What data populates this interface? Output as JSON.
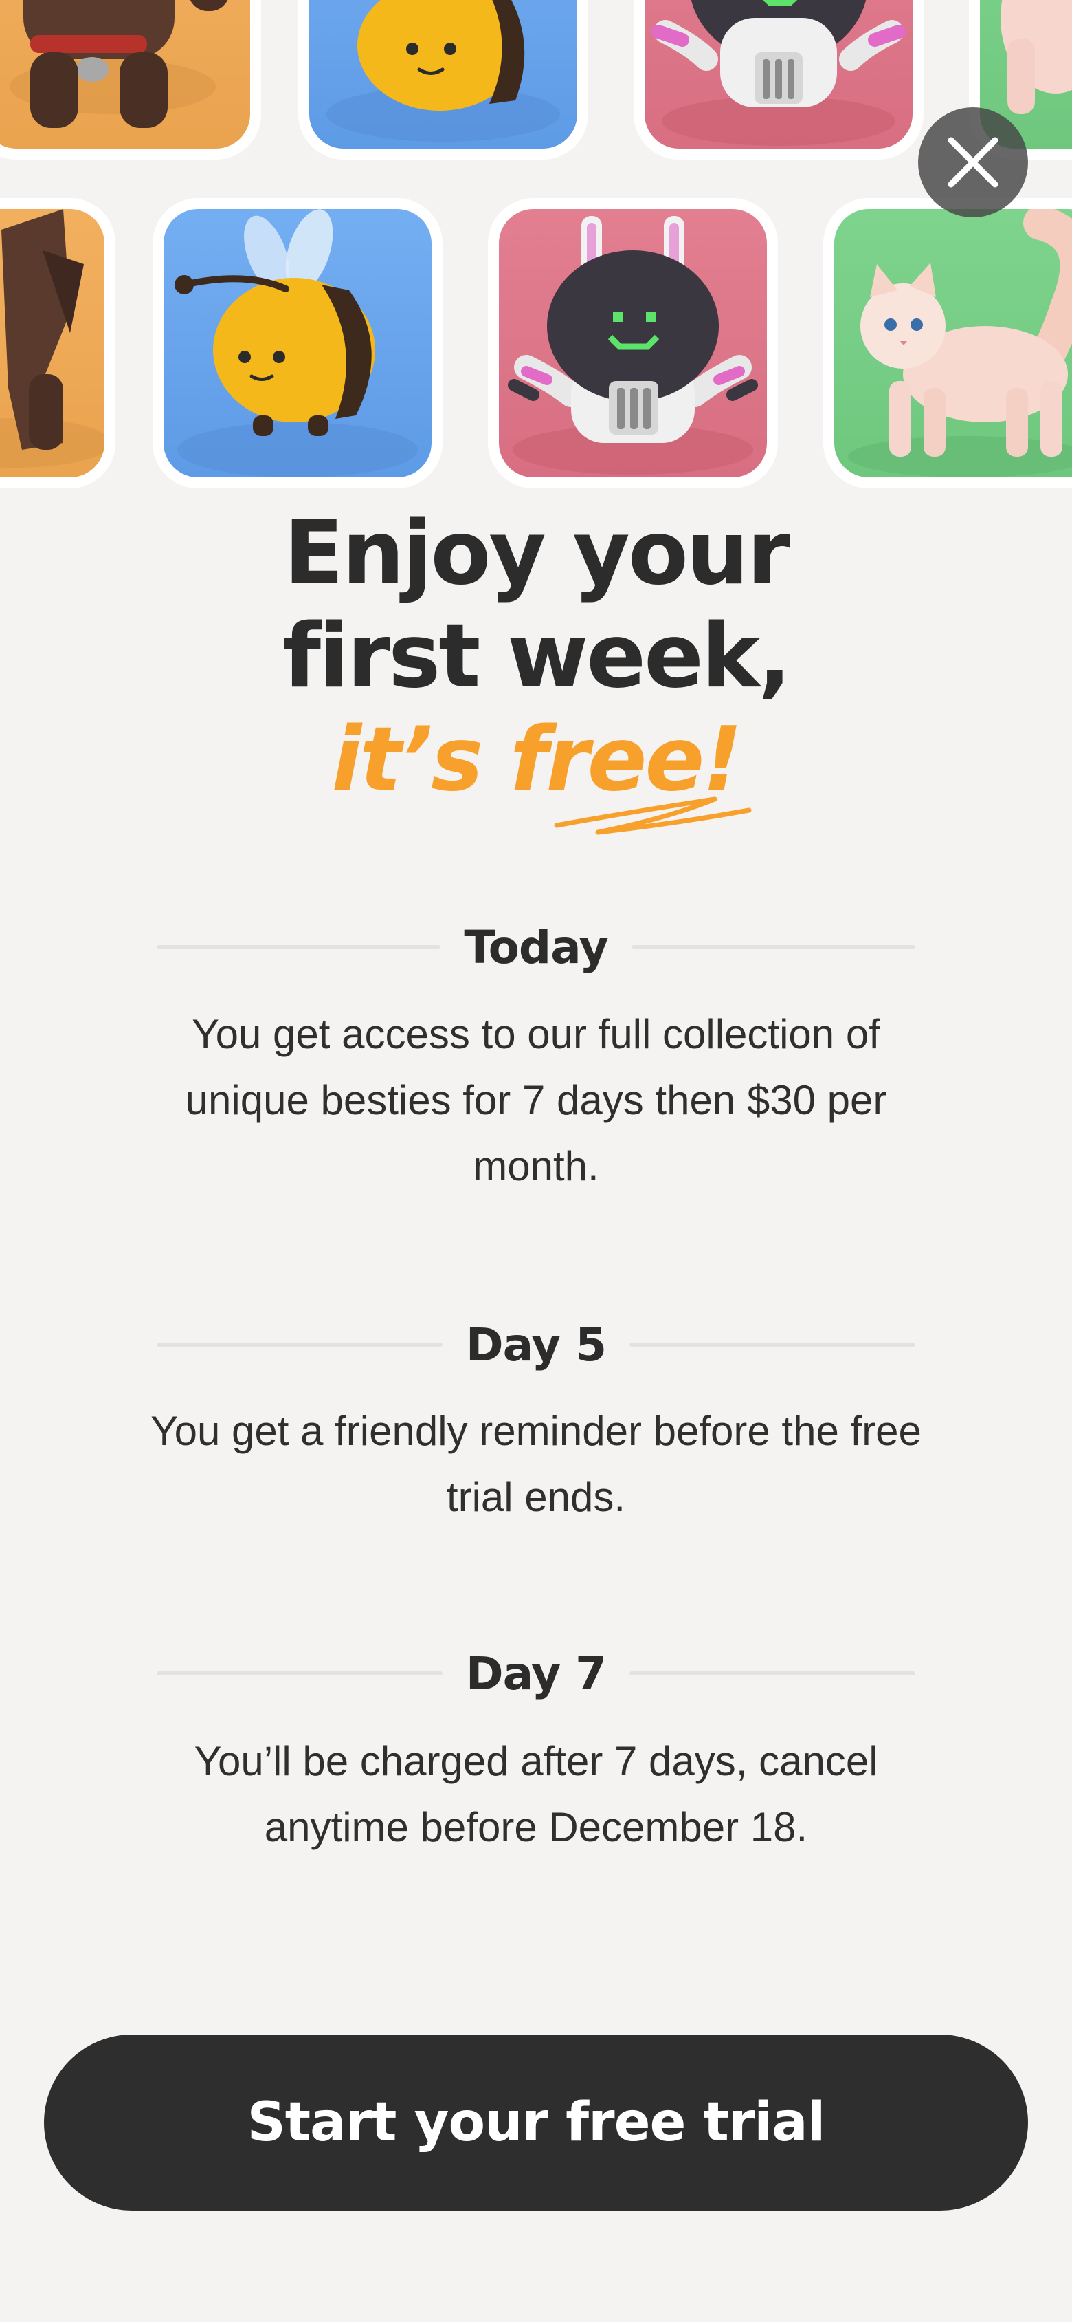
{
  "colors": {
    "background": "#f4f3f1",
    "accent": "#f7a12c",
    "text_dark": "#2c2c2c",
    "cta_background": "#2e2e2e",
    "tile_orange": "#eea957",
    "tile_blue": "#6aa6ee",
    "tile_pink": "#dc7689",
    "tile_green": "#76cd85"
  },
  "carousel": {
    "row1": [
      {
        "character": "dog",
        "icon": "dog-character-icon"
      },
      {
        "character": "bee",
        "icon": "bee-character-icon"
      },
      {
        "character": "robot",
        "icon": "robot-character-icon"
      },
      {
        "character": "cat",
        "icon": "cat-character-icon"
      }
    ],
    "row2": [
      {
        "character": "dog",
        "icon": "dog-character-icon"
      },
      {
        "character": "bee",
        "icon": "bee-character-icon"
      },
      {
        "character": "robot",
        "icon": "robot-character-icon"
      },
      {
        "character": "cat",
        "icon": "cat-character-icon"
      }
    ]
  },
  "close": {
    "icon": "close-icon"
  },
  "headline": {
    "line1": "Enjoy your",
    "line2": "first week,",
    "line3": "it’s free!"
  },
  "steps": [
    {
      "title": "Today",
      "body": "You get access to our full collection of unique besties for 7 days then $30 per month."
    },
    {
      "title": "Day 5",
      "body": "You get a friendly reminder before the free trial ends."
    },
    {
      "title": "Day 7",
      "body": "You’ll be charged after 7 days, cancel anytime before December 18."
    }
  ],
  "cta": {
    "label": "Start your free trial"
  }
}
